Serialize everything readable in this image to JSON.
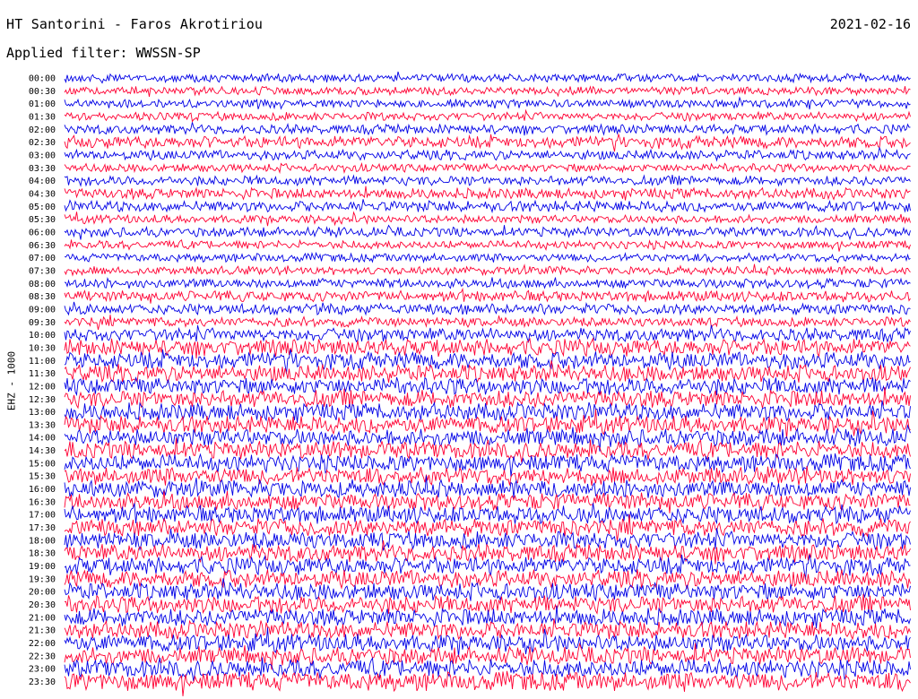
{
  "header": {
    "station": "HT Santorini - Faros Akrotiriou",
    "date": "2021-02-16",
    "filter": "Applied filter: WWSSN-SP"
  },
  "channel_label": "EHZ - 1000",
  "colors": {
    "trace_primary": "#0000e6",
    "trace_secondary": "#ff0033",
    "background": "#ffffff",
    "text": "#000000"
  },
  "chart_data": {
    "type": "line",
    "title": "HT Santorini - Faros Akrotiriou",
    "subtitle": "Applied filter: WWSSN-SP",
    "date": "2021-02-16",
    "ylabel": "EHZ - 1000",
    "row_interval_minutes": 30,
    "color_cycle": [
      "blue",
      "red"
    ],
    "rows": [
      {
        "label": "00:00",
        "amplitude": 0.35
      },
      {
        "label": "00:30",
        "amplitude": 0.35
      },
      {
        "label": "01:00",
        "amplitude": 0.35
      },
      {
        "label": "01:30",
        "amplitude": 0.35
      },
      {
        "label": "02:00",
        "amplitude": 0.4
      },
      {
        "label": "02:30",
        "amplitude": 0.5
      },
      {
        "label": "03:00",
        "amplitude": 0.4
      },
      {
        "label": "03:30",
        "amplitude": 0.35
      },
      {
        "label": "04:00",
        "amplitude": 0.4
      },
      {
        "label": "04:30",
        "amplitude": 0.45
      },
      {
        "label": "05:00",
        "amplitude": 0.45
      },
      {
        "label": "05:30",
        "amplitude": 0.35
      },
      {
        "label": "06:00",
        "amplitude": 0.4
      },
      {
        "label": "06:30",
        "amplitude": 0.35
      },
      {
        "label": "07:00",
        "amplitude": 0.35
      },
      {
        "label": "07:30",
        "amplitude": 0.35
      },
      {
        "label": "08:00",
        "amplitude": 0.4
      },
      {
        "label": "08:30",
        "amplitude": 0.45
      },
      {
        "label": "09:00",
        "amplitude": 0.45
      },
      {
        "label": "09:30",
        "amplitude": 0.4
      },
      {
        "label": "10:00",
        "amplitude": 0.55
      },
      {
        "label": "10:30",
        "amplitude": 0.7
      },
      {
        "label": "11:00",
        "amplitude": 0.7
      },
      {
        "label": "11:30",
        "amplitude": 0.7
      },
      {
        "label": "12:00",
        "amplitude": 0.7
      },
      {
        "label": "12:30",
        "amplitude": 0.72
      },
      {
        "label": "13:00",
        "amplitude": 0.72
      },
      {
        "label": "13:30",
        "amplitude": 0.72
      },
      {
        "label": "14:00",
        "amplitude": 0.72
      },
      {
        "label": "14:30",
        "amplitude": 0.72
      },
      {
        "label": "15:00",
        "amplitude": 0.72
      },
      {
        "label": "15:30",
        "amplitude": 0.72
      },
      {
        "label": "16:00",
        "amplitude": 0.72
      },
      {
        "label": "16:30",
        "amplitude": 0.72
      },
      {
        "label": "17:00",
        "amplitude": 0.72
      },
      {
        "label": "17:30",
        "amplitude": 0.72
      },
      {
        "label": "18:00",
        "amplitude": 0.72
      },
      {
        "label": "18:30",
        "amplitude": 0.72
      },
      {
        "label": "19:00",
        "amplitude": 0.72
      },
      {
        "label": "19:30",
        "amplitude": 0.72
      },
      {
        "label": "20:00",
        "amplitude": 0.72
      },
      {
        "label": "20:30",
        "amplitude": 0.72
      },
      {
        "label": "21:00",
        "amplitude": 0.72
      },
      {
        "label": "21:30",
        "amplitude": 0.72
      },
      {
        "label": "22:00",
        "amplitude": 0.72
      },
      {
        "label": "22:30",
        "amplitude": 0.72
      },
      {
        "label": "23:00",
        "amplitude": 0.75
      },
      {
        "label": "23:30",
        "amplitude": 0.78
      }
    ]
  }
}
